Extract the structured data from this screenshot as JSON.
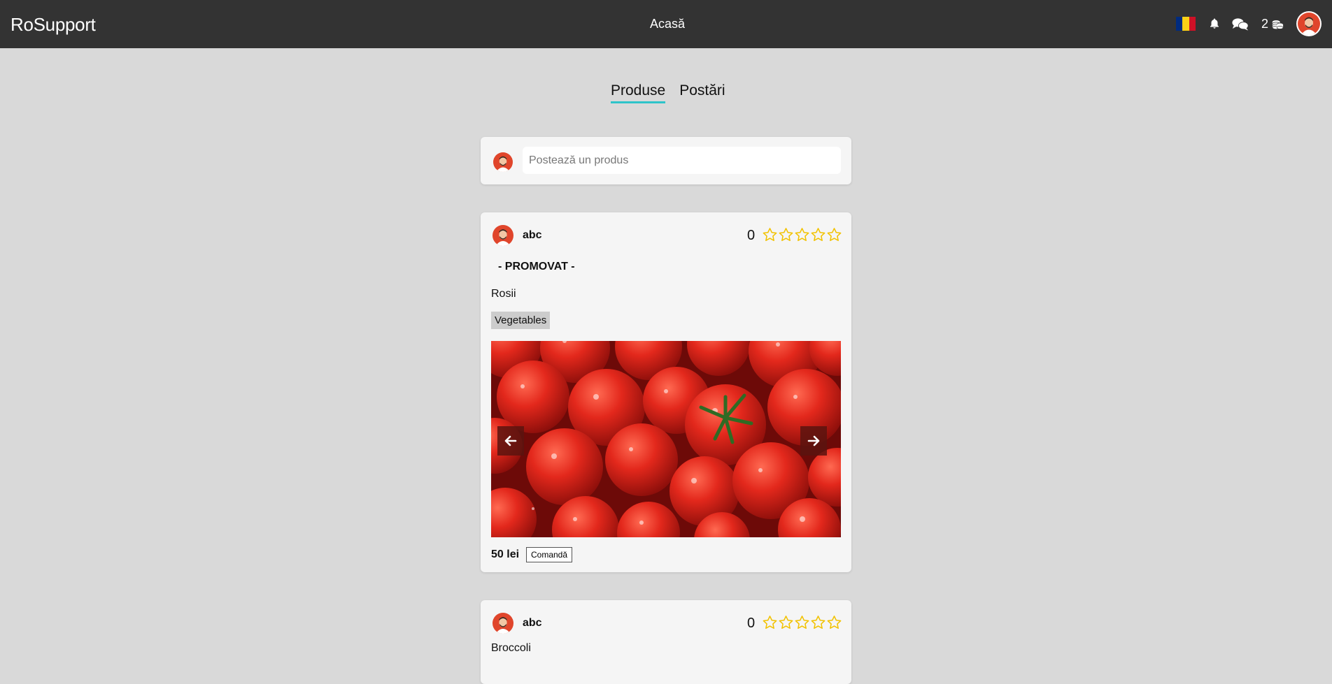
{
  "app": {
    "brand": "RoSupport",
    "nav_home": "Acasă",
    "coins": "2"
  },
  "tabs": [
    {
      "label": "Produse",
      "active": true
    },
    {
      "label": "Postări",
      "active": false
    }
  ],
  "composer": {
    "placeholder": "Postează un produs"
  },
  "products": [
    {
      "user": "abc",
      "rating": "0",
      "stars_max": 5,
      "promo_label": "- PROMOVAT -",
      "name": "Rosii",
      "category": "Vegetables",
      "price": "50 lei",
      "order_label": "Comandă"
    },
    {
      "user": "abc",
      "rating": "0",
      "stars_max": 5,
      "name": "Broccoli"
    }
  ],
  "colors": {
    "topbar": "#333333",
    "background": "#d9d9d9",
    "card": "#f5f5f5",
    "tab_underline": "#2ec4c9",
    "star": "#f2c200",
    "flag_blue": "#002b7f",
    "flag_yellow": "#fcd116",
    "flag_red": "#ce1126"
  },
  "icons": {
    "flag": "romania-flag-icon",
    "notifications": "bell-icon",
    "messages": "chat-icon",
    "coins": "coins-icon",
    "prev": "arrow-left-icon",
    "next": "arrow-right-icon"
  }
}
